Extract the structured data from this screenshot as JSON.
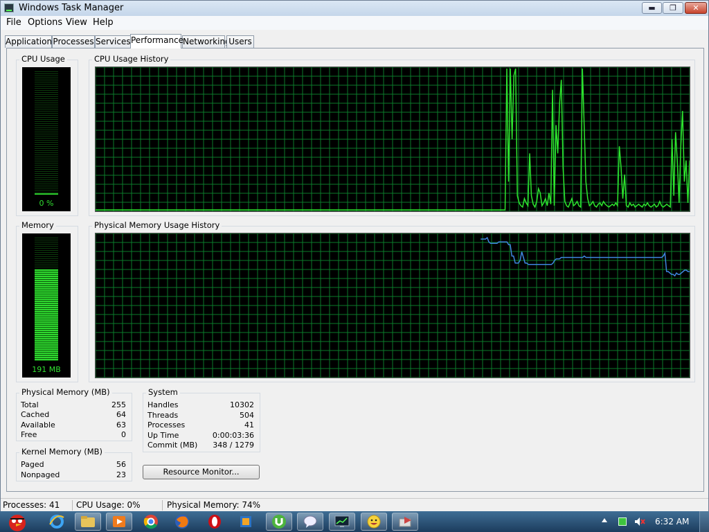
{
  "window": {
    "title": "Windows Task Manager",
    "minimize": "▬",
    "maximize": "❐",
    "close": "✕"
  },
  "menu": [
    "File",
    "Options",
    "View",
    "Help"
  ],
  "tabs": [
    {
      "label": "Applications",
      "active": false
    },
    {
      "label": "Processes",
      "active": false
    },
    {
      "label": "Services",
      "active": false
    },
    {
      "label": "Performance",
      "active": true
    },
    {
      "label": "Networking",
      "active": false
    },
    {
      "label": "Users",
      "active": false
    }
  ],
  "cpu": {
    "label": "CPU Usage",
    "value": "0 %",
    "percent": 0
  },
  "cpu_history": {
    "label": "CPU Usage History",
    "color": "#2ee52e",
    "values": [
      0,
      0,
      0,
      0,
      0,
      0,
      0,
      0,
      0,
      0,
      0,
      0,
      0,
      0,
      0,
      0,
      0,
      0,
      0,
      0,
      0,
      0,
      0,
      0,
      0,
      0,
      0,
      0,
      0,
      0,
      0,
      0,
      0,
      0,
      0,
      0,
      0,
      0,
      0,
      0,
      0,
      0,
      0,
      0,
      0,
      0,
      0,
      0,
      0,
      0,
      0,
      0,
      0,
      0,
      0,
      0,
      0,
      0,
      0,
      0,
      0,
      0,
      0,
      0,
      0,
      0,
      0,
      0,
      0,
      0,
      0,
      0,
      0,
      0,
      0,
      0,
      0,
      0,
      0,
      0,
      0,
      0,
      0,
      0,
      0,
      0,
      0,
      0,
      0,
      0,
      0,
      0,
      0,
      0,
      0,
      0,
      0,
      0,
      0,
      0,
      0,
      0,
      0,
      0,
      0,
      0,
      0,
      0,
      0,
      0,
      0,
      0,
      0,
      0,
      0,
      0,
      0,
      0,
      0,
      0,
      0,
      0,
      0,
      0,
      0,
      0,
      0,
      0,
      0,
      0,
      0,
      0,
      0,
      0,
      0,
      0,
      0,
      0,
      0,
      0,
      0,
      0,
      0,
      0,
      0,
      0,
      0,
      0,
      0,
      0,
      0,
      0,
      0,
      0,
      0,
      0,
      0,
      0,
      0,
      0,
      0,
      0,
      0,
      0,
      0,
      0,
      0,
      0,
      0,
      0,
      0,
      0,
      0,
      0,
      0,
      0,
      0,
      0,
      0,
      0,
      0,
      0,
      0,
      0,
      0,
      0,
      0,
      0,
      0,
      0,
      0,
      0,
      0,
      0,
      0,
      0,
      0,
      0,
      0,
      0,
      0,
      0,
      0,
      0,
      0,
      0,
      0,
      0,
      0,
      0,
      0,
      0,
      0,
      0,
      0,
      0,
      0,
      0,
      0,
      0,
      0,
      0,
      0,
      0,
      0,
      0,
      0,
      0,
      0,
      0,
      0,
      0,
      0,
      0,
      100,
      20,
      100,
      50,
      95,
      100,
      10,
      5,
      3,
      2,
      8,
      5,
      3,
      40,
      10,
      4,
      2,
      6,
      15,
      12,
      3,
      5,
      8,
      3,
      12,
      4,
      85,
      3,
      60,
      40,
      75,
      92,
      30,
      6,
      3,
      2,
      5,
      8,
      3,
      4,
      6,
      3,
      2,
      100,
      60,
      20,
      8,
      3,
      4,
      6,
      3,
      2,
      4,
      5,
      3,
      6,
      4,
      3,
      2,
      3,
      4,
      3,
      5,
      3,
      45,
      30,
      8,
      25,
      3,
      2,
      5,
      3,
      4,
      2,
      3,
      4,
      3,
      2,
      4,
      3,
      5,
      3,
      2,
      3,
      4,
      2,
      3,
      6,
      3,
      2,
      3,
      4,
      3,
      2,
      50,
      10,
      55,
      35,
      5,
      45,
      70,
      20,
      35,
      5,
      35
    ]
  },
  "memory": {
    "label": "Memory",
    "value": "191 MB",
    "percent": 74
  },
  "memory_history": {
    "label": "Physical Memory Usage History",
    "color": "#3f86e0",
    "values": [
      null,
      null,
      null,
      null,
      null,
      null,
      null,
      null,
      null,
      null,
      null,
      null,
      null,
      null,
      null,
      null,
      null,
      null,
      null,
      null,
      null,
      null,
      null,
      null,
      null,
      null,
      null,
      null,
      null,
      null,
      null,
      null,
      null,
      null,
      null,
      null,
      null,
      null,
      null,
      null,
      null,
      null,
      null,
      null,
      null,
      null,
      null,
      null,
      null,
      null,
      null,
      null,
      null,
      null,
      null,
      null,
      null,
      null,
      null,
      null,
      null,
      null,
      null,
      null,
      null,
      null,
      null,
      null,
      null,
      null,
      null,
      null,
      null,
      null,
      null,
      null,
      null,
      null,
      null,
      null,
      null,
      null,
      null,
      null,
      null,
      null,
      null,
      null,
      null,
      null,
      null,
      null,
      null,
      null,
      null,
      null,
      null,
      null,
      null,
      null,
      null,
      null,
      null,
      null,
      null,
      null,
      null,
      null,
      null,
      null,
      null,
      null,
      null,
      null,
      null,
      null,
      null,
      null,
      null,
      null,
      null,
      null,
      null,
      null,
      null,
      null,
      null,
      null,
      null,
      null,
      null,
      null,
      null,
      null,
      null,
      null,
      null,
      null,
      null,
      null,
      null,
      null,
      null,
      null,
      null,
      null,
      null,
      null,
      null,
      null,
      null,
      null,
      null,
      null,
      null,
      null,
      null,
      null,
      null,
      null,
      null,
      null,
      null,
      null,
      null,
      null,
      null,
      null,
      null,
      null,
      null,
      null,
      null,
      null,
      null,
      null,
      null,
      null,
      null,
      null,
      null,
      null,
      null,
      null,
      null,
      null,
      null,
      null,
      null,
      null,
      null,
      null,
      null,
      null,
      null,
      null,
      null,
      null,
      null,
      null,
      null,
      null,
      null,
      null,
      null,
      null,
      null,
      null,
      null,
      null,
      null,
      null,
      null,
      null,
      null,
      null,
      null,
      null,
      null,
      null,
      null,
      null,
      null,
      null,
      null,
      null,
      null,
      null,
      null,
      null,
      null,
      null,
      null,
      null,
      97,
      97,
      97,
      97,
      98,
      95,
      94,
      94,
      94,
      94,
      94,
      95,
      95,
      95,
      95,
      95,
      95,
      93,
      93,
      85,
      85,
      80,
      80,
      80,
      82,
      88,
      84,
      80,
      80,
      79,
      79,
      79,
      79,
      79,
      79,
      79,
      79,
      79,
      79,
      79,
      79,
      79,
      79,
      79,
      80,
      82,
      83,
      83,
      83,
      84,
      84,
      84,
      84,
      84,
      84,
      84,
      84,
      84,
      84,
      84,
      84,
      84,
      84,
      85,
      84,
      84,
      84,
      84,
      84,
      84,
      84,
      84,
      84,
      84,
      84,
      84,
      84,
      84,
      84,
      84,
      84,
      84,
      84,
      84,
      84,
      84,
      84,
      84,
      84,
      84,
      84,
      84,
      84,
      84,
      84,
      84,
      84,
      84,
      84,
      84,
      84,
      84,
      84,
      84,
      84,
      84,
      84,
      84,
      84,
      84,
      84,
      85,
      87,
      74,
      74,
      73,
      72,
      72,
      71,
      73,
      72,
      72,
      73,
      74,
      75,
      75,
      74,
      74
    ]
  },
  "physical_memory": {
    "label": "Physical Memory (MB)",
    "rows": [
      {
        "k": "Total",
        "v": "255"
      },
      {
        "k": "Cached",
        "v": "64"
      },
      {
        "k": "Available",
        "v": "63"
      },
      {
        "k": "Free",
        "v": "0"
      }
    ]
  },
  "kernel_memory": {
    "label": "Kernel Memory (MB)",
    "rows": [
      {
        "k": "Paged",
        "v": "56"
      },
      {
        "k": "Nonpaged",
        "v": "23"
      }
    ]
  },
  "system": {
    "label": "System",
    "rows": [
      {
        "k": "Handles",
        "v": "10302"
      },
      {
        "k": "Threads",
        "v": "504"
      },
      {
        "k": "Processes",
        "v": "41"
      },
      {
        "k": "Up Time",
        "v": "0:00:03:36"
      },
      {
        "k": "Commit (MB)",
        "v": "348 / 1279"
      }
    ]
  },
  "resource_monitor_label": "Resource Monitor...",
  "status": {
    "processes": "Processes: 41",
    "cpu": "CPU Usage: 0%",
    "memory": "Physical Memory: 74%"
  },
  "taskbar": {
    "clock": "6:32 AM",
    "items": [
      "angry-birds-icon",
      "internet-explorer-icon",
      "folder-icon",
      "media-player-icon",
      "chrome-icon",
      "firefox-icon",
      "opera-icon",
      "app-icon",
      "utorrent-icon",
      "chat-icon",
      "task-manager-icon",
      "smiley-icon",
      "tools-icon"
    ]
  }
}
